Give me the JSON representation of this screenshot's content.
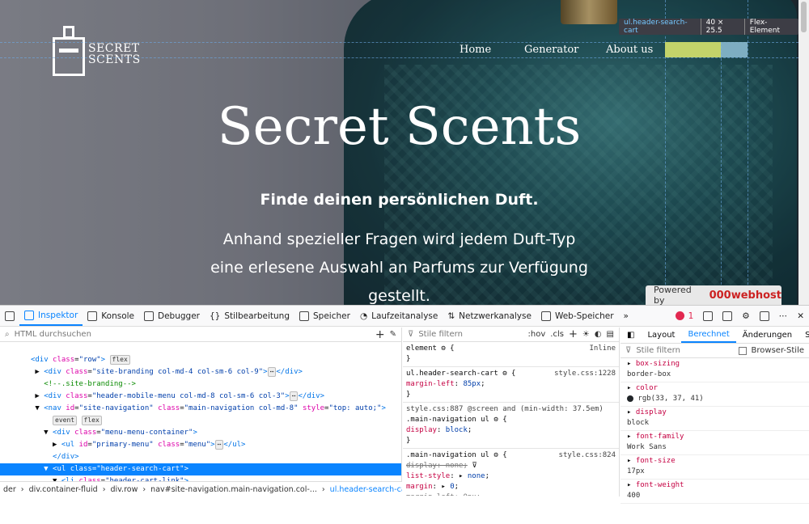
{
  "site": {
    "logo_line1": "SECRET",
    "logo_line2": "SCENTS",
    "nav": [
      "Home",
      "Generator",
      "About us"
    ],
    "title": "Secret Scents",
    "subtitle": "Finde deinen persönlichen Duft.",
    "desc": [
      "Anhand spezieller Fragen wird jedem Duft-Typ",
      "eine erlesene Auswahl an Parfums zur Verfügung",
      "gestellt."
    ],
    "powered_by": "Powered by",
    "host": "000webhost"
  },
  "tooltip": {
    "selector": "ul.header-search-cart",
    "size": "40 × 25.5",
    "kind": "Flex-Element"
  },
  "devtools": {
    "tabs": [
      "Inspektor",
      "Konsole",
      "Debugger",
      "Stilbearbeitung",
      "Speicher",
      "Laufzeitanalyse",
      "Netzwerkanalyse",
      "Web-Speicher"
    ],
    "error_count": "1",
    "html_search_placeholder": "HTML durchsuchen",
    "styles_filter_placeholder": "Stile filtern",
    "hov": ":hov",
    "cls": ".cls",
    "right_tabs": [
      "Layout",
      "Berechnet",
      "Änderungen",
      "Sc"
    ],
    "browser_styles": "Browser-Stile",
    "breadcrumbs": [
      "der",
      "div.container-fluid",
      "div.row",
      "nav#site-navigation.main-navigation.col-...",
      "ul.header-search-cart"
    ],
    "computed": [
      {
        "name": "box-sizing",
        "value": "border-box"
      },
      {
        "name": "color",
        "value": "rgb(33, 37, 41)"
      },
      {
        "name": "display",
        "value": "block"
      },
      {
        "name": "font-family",
        "value": "Work Sans"
      },
      {
        "name": "font-size",
        "value": "17px"
      },
      {
        "name": "font-weight",
        "value": "400"
      }
    ]
  },
  "colors": {
    "accent": "#0a84ff",
    "highlight_content": "#c3d36a",
    "highlight_padding": "#8ab9cf"
  }
}
